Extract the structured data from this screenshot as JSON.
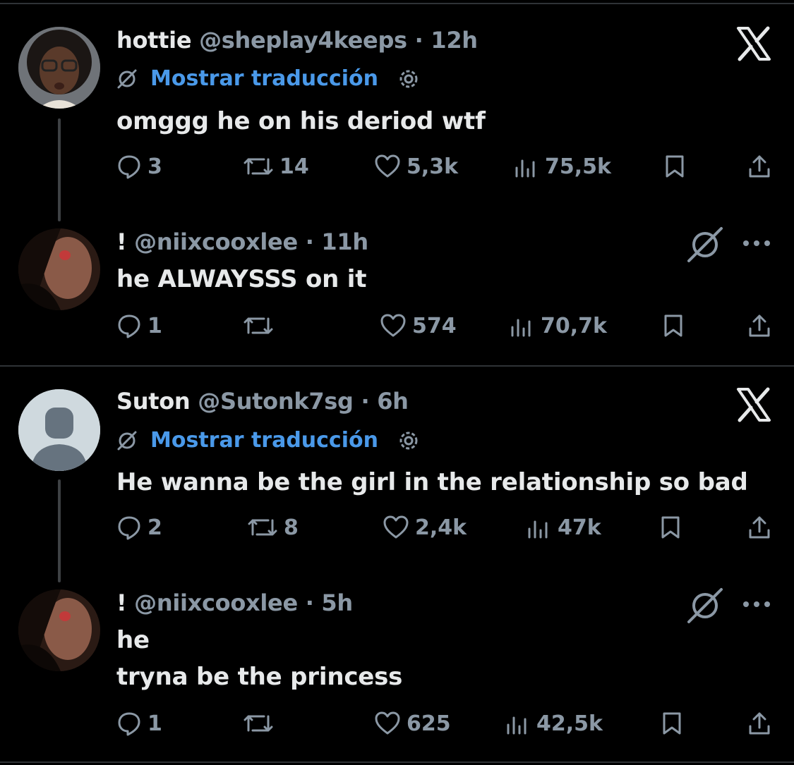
{
  "threads": [
    {
      "original": {
        "name": "hottie",
        "handle": "@sheplay4keeps",
        "time": "12h",
        "translate_label": "Mostrar traducción",
        "text_lines": [
          "omggg he on his deriod wtf"
        ],
        "stats": {
          "replies": "3",
          "reposts": "14",
          "likes": "5,3k",
          "views": "75,5k"
        }
      },
      "reply": {
        "name": "!",
        "handle": "@niixcooxlee",
        "time": "11h",
        "text_lines": [
          "he ALWAYSSS on it"
        ],
        "stats": {
          "replies": "1",
          "reposts": "",
          "likes": "574",
          "views": "70,7k"
        }
      }
    },
    {
      "original": {
        "name": "Suton",
        "handle": "@Sutonk7sg",
        "time": "6h",
        "translate_label": "Mostrar traducción",
        "text_lines": [
          "He wanna be the girl in the relationship so bad"
        ],
        "stats": {
          "replies": "2",
          "reposts": "8",
          "likes": "2,4k",
          "views": "47k"
        }
      },
      "reply": {
        "name": "!",
        "handle": "@niixcooxlee",
        "time": "5h",
        "text_lines": [
          "he",
          "tryna be the princess"
        ],
        "stats": {
          "replies": "1",
          "reposts": "",
          "likes": "625",
          "views": "42,5k"
        }
      }
    }
  ],
  "colors": {
    "background": "#000000",
    "text": "#e7e9ea",
    "muted": "#8b98a5",
    "link": "#4a99e9",
    "divider": "#2f3336"
  },
  "icons": [
    "x-logo-icon",
    "grok-icon",
    "more-icon",
    "translate-icon",
    "gear-icon",
    "reply-icon",
    "repost-icon",
    "like-icon",
    "views-icon",
    "bookmark-icon",
    "share-icon"
  ]
}
